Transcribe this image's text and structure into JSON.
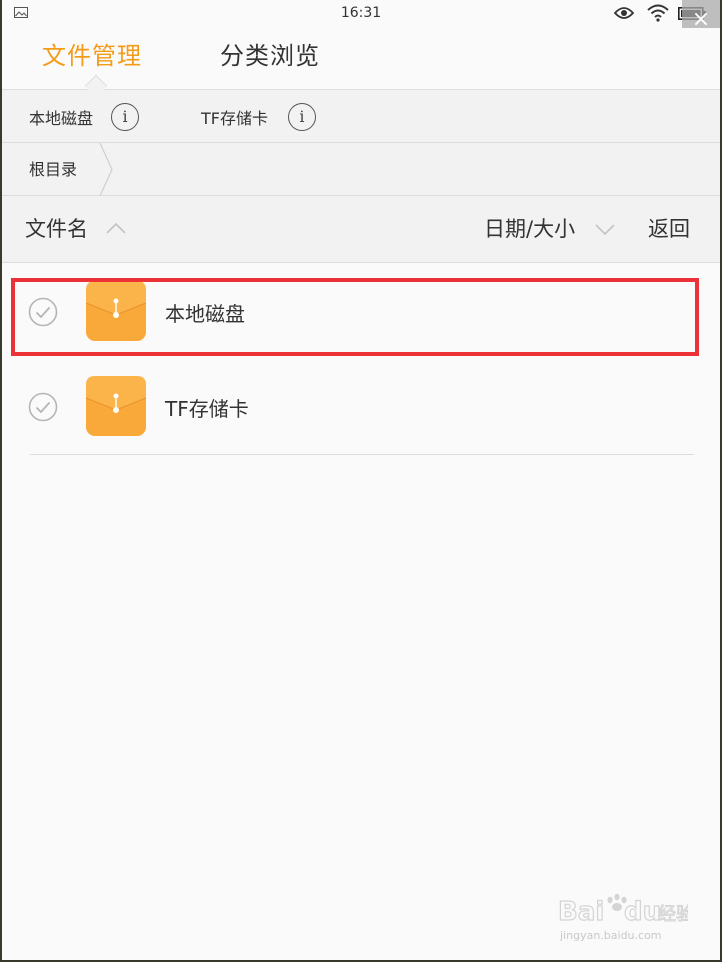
{
  "status_bar": {
    "time": "16:31",
    "icons": [
      "image-icon",
      "eye-icon",
      "wifi-icon",
      "battery-icon"
    ]
  },
  "overlay": {
    "close_glyph": "×"
  },
  "tabs": [
    {
      "label": "文件管理",
      "active": true
    },
    {
      "label": "分类浏览",
      "active": false
    }
  ],
  "storage": [
    {
      "label": "本地磁盘",
      "icon": "info-icon"
    },
    {
      "label": "TF存储卡",
      "icon": "info-icon"
    }
  ],
  "breadcrumb": {
    "root": "根目录"
  },
  "list_header": {
    "name_label": "文件名",
    "date_size_label": "日期/大小",
    "back_label": "返回"
  },
  "files": [
    {
      "name": "本地磁盘",
      "icon": "folder-icon",
      "highlighted": true
    },
    {
      "name": "TF存储卡",
      "icon": "folder-icon",
      "highlighted": false
    }
  ],
  "colors": {
    "accent": "#f39c1a",
    "folder": "#f9a83a",
    "highlight": "#ec3237"
  },
  "watermark": {
    "url": "jingyan.baidu.com"
  }
}
